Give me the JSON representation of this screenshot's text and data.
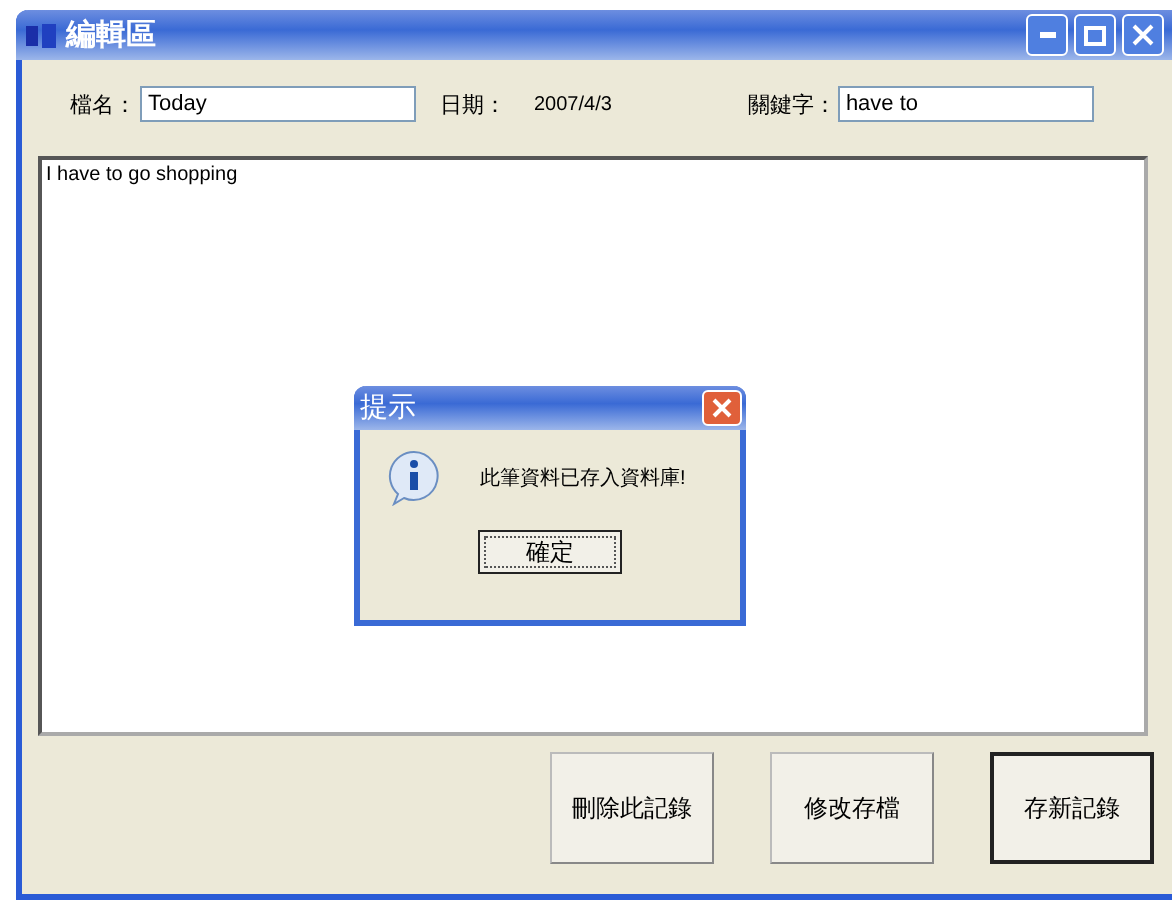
{
  "window": {
    "title": "編輯區"
  },
  "fields": {
    "filename_label": "檔名：",
    "filename_value": "Today",
    "date_label": "日期：",
    "date_value": "2007/4/3",
    "keyword_label": "關鍵字：",
    "keyword_value": "have to"
  },
  "content": {
    "value": "I have to go shopping"
  },
  "dialog": {
    "title": "提示",
    "message": "此筆資料已存入資料庫!",
    "button": "確定"
  },
  "buttons": [
    {
      "label": "刪除此記錄",
      "default": false
    },
    {
      "label": "修改存檔",
      "default": false
    },
    {
      "label": "存新記錄",
      "default": true
    }
  ]
}
